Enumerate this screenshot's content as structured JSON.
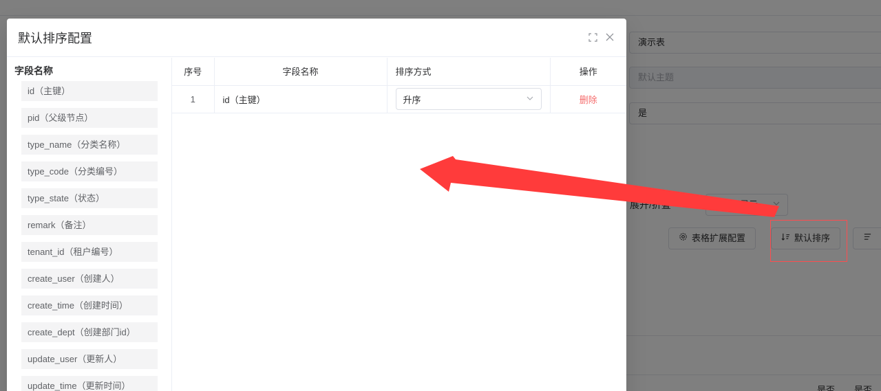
{
  "background": {
    "table_name_value": "演示表",
    "theme_placeholder": "默认主题",
    "yes_value": "是",
    "expand_label": "展开/折叠",
    "expand_select": "双按钮显示",
    "table_ext_button": "表格扩展配置",
    "default_sort_button": "默认排序",
    "partial_button": "",
    "header_yes_1": "是否",
    "header_yes_2": "是否"
  },
  "dialog": {
    "title": "默认排序配置",
    "left_title": "字段名称",
    "fields": [
      "id（主键）",
      "pid（父级节点）",
      "type_name（分类名称）",
      "type_code（分类编号）",
      "type_state（状态）",
      "remark（备注）",
      "tenant_id（租户编号）",
      "create_user（创建人）",
      "create_time（创建时间）",
      "create_dept（创建部门id）",
      "update_user（更新人）",
      "update_time（更新时间）"
    ],
    "table": {
      "headers": [
        "序号",
        "字段名称",
        "排序方式",
        "操作"
      ],
      "rows": [
        {
          "index": "1",
          "field": "id（主键）",
          "sort": "升序",
          "action": "删除"
        }
      ]
    }
  },
  "colors": {
    "accent": "#409eff",
    "danger": "#f56c6c",
    "arrow": "#ff3b3b"
  }
}
